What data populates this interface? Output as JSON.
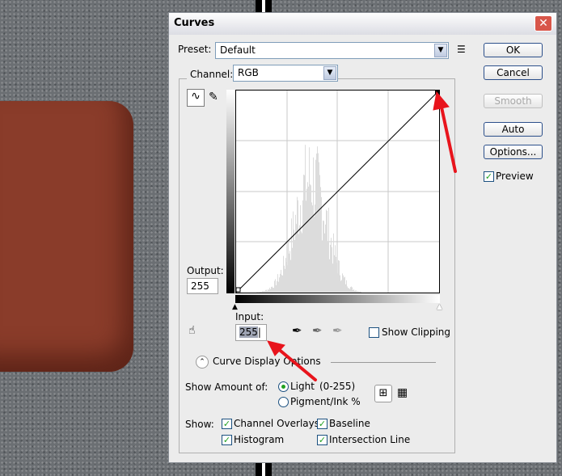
{
  "dialog": {
    "title": "Curves",
    "close_icon": "close-icon"
  },
  "preset": {
    "label": "Preset:",
    "value": "Default"
  },
  "channel": {
    "label": "Channel:",
    "value": "RGB"
  },
  "buttons": {
    "ok": "OK",
    "cancel": "Cancel",
    "smooth": "Smooth",
    "auto": "Auto",
    "options": "Options..."
  },
  "preview": {
    "label": "Preview",
    "checked": true
  },
  "output": {
    "label": "Output:",
    "value": "255"
  },
  "input": {
    "label": "Input:",
    "value": "255"
  },
  "show_clipping": {
    "label": "Show Clipping",
    "checked": false
  },
  "curve_display_options": "Curve Display Options",
  "show_amount": {
    "label": "Show Amount of:",
    "light": "Light",
    "light_range": "(0-255)",
    "pigment": "Pigment/Ink %",
    "selected": "Light"
  },
  "show": {
    "label": "Show:",
    "channel_overlays": "Channel Overlays",
    "baseline": "Baseline",
    "histogram": "Histogram",
    "intersection_line": "Intersection Line"
  },
  "colors": {
    "annotation_arrow": "#e8141c",
    "button_border": "#2c4f8a"
  }
}
